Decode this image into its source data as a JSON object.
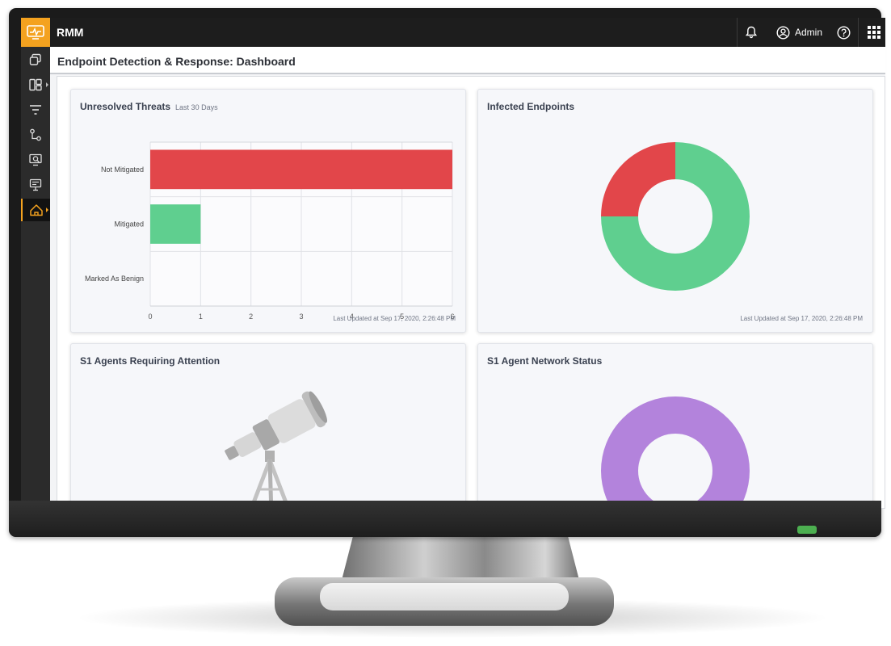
{
  "app": {
    "title": "RMM",
    "user": "Admin"
  },
  "header": {
    "title": "Endpoint Detection & Response: Dashboard"
  },
  "icons": {
    "logo": "monitor-pulse-icon",
    "bell": "bell-icon",
    "user": "user-circle-icon",
    "help": "help-circle-icon",
    "apps": "grid-apps-icon"
  },
  "sidebar": {
    "items": [
      {
        "icon": "devices-icon"
      },
      {
        "icon": "dashboard-widgets-icon",
        "submenu": true
      },
      {
        "icon": "filter-icon"
      },
      {
        "icon": "workflow-icon"
      },
      {
        "icon": "search-monitor-icon"
      },
      {
        "icon": "reports-icon"
      },
      {
        "icon": "edr-shield-icon",
        "submenu": true,
        "active": true
      }
    ]
  },
  "cards": {
    "threats": {
      "title": "Unresolved Threats",
      "subtitle": "Last 30 Days",
      "updated": "Last Updated at Sep 17, 2020, 2:26:48 PM"
    },
    "infected": {
      "title": "Infected Endpoints",
      "updated": "Last Updated at Sep 17, 2020, 2:26:48 PM"
    },
    "agents": {
      "title": "S1 Agents Requiring Attention",
      "illustration": "telescope-illustration"
    },
    "network": {
      "title": "S1 Agent Network Status"
    }
  },
  "colors": {
    "accent": "#f4a21f",
    "red": "#e2464a",
    "green": "#5fcf8f",
    "purple": "#b383dc"
  },
  "chart_data": [
    {
      "type": "bar",
      "orientation": "horizontal",
      "title": "Unresolved Threats",
      "categories": [
        "Not Mitigated",
        "Mitigated",
        "Marked As Benign"
      ],
      "values": [
        6,
        1,
        0
      ],
      "colors": [
        "#e2464a",
        "#5fcf8f",
        "#cccccc"
      ],
      "xlim": [
        0,
        6
      ],
      "xticks": [
        "0",
        "1",
        "2",
        "3",
        "4",
        "5",
        "6"
      ],
      "grid": true
    },
    {
      "type": "pie",
      "donut": true,
      "title": "Infected Endpoints",
      "values": [
        25,
        75
      ],
      "colors": [
        "#e2464a",
        "#5fcf8f"
      ]
    },
    {
      "type": "pie",
      "donut": true,
      "title": "S1 Agent Network Status",
      "values": [
        100
      ],
      "colors": [
        "#b383dc"
      ]
    }
  ]
}
